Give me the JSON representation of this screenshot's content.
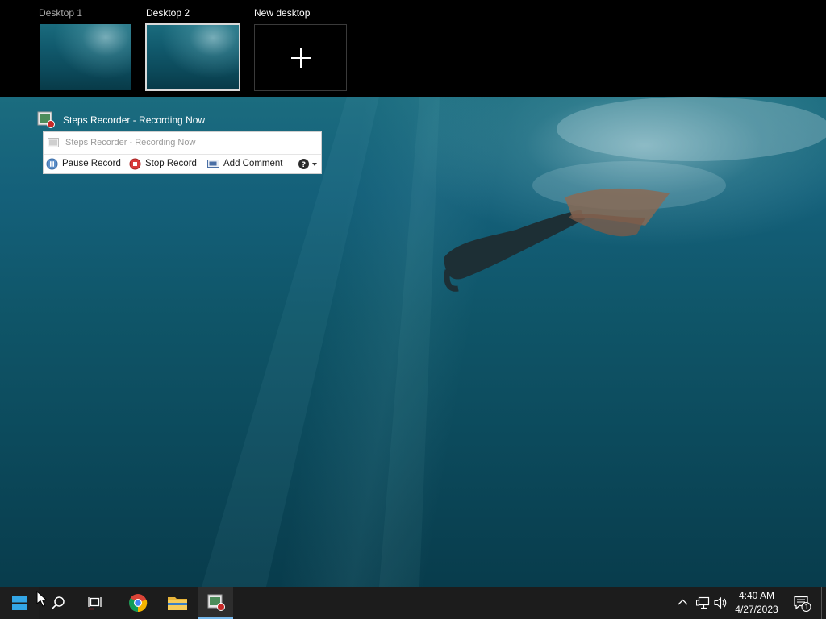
{
  "virtual_desktops": [
    {
      "label": "Desktop 1",
      "selected": false
    },
    {
      "label": "Desktop 2",
      "selected": true
    }
  ],
  "new_desktop": {
    "label": "New desktop"
  },
  "window_caption": {
    "title": "Steps Recorder - Recording Now",
    "icon": "steps-recorder-icon"
  },
  "steps_recorder": {
    "title": "Steps Recorder - Recording Now",
    "buttons": [
      {
        "label": "Pause Record",
        "icon": "pause-icon"
      },
      {
        "label": "Stop Record",
        "icon": "stop-icon"
      },
      {
        "label": "Add Comment",
        "icon": "comment-icon"
      },
      {
        "label": "",
        "icon": "help-icon"
      }
    ]
  },
  "taskbar": {
    "items": [
      {
        "name": "start",
        "icon": "windows-logo-icon"
      },
      {
        "name": "search",
        "icon": "search-icon"
      },
      {
        "name": "task-view",
        "icon": "task-view-icon"
      },
      {
        "name": "chrome",
        "icon": "chrome-icon"
      },
      {
        "name": "file-explorer",
        "icon": "folder-icon"
      },
      {
        "name": "steps-recorder",
        "icon": "steps-recorder-icon",
        "active": true
      }
    ],
    "tray": {
      "time": "4:40 AM",
      "date": "4/27/2023",
      "notification_count": "1"
    }
  },
  "colors": {
    "taskbar": "#1c1c1c",
    "accent": "#76b9ed",
    "ocean": "#0f5568"
  }
}
